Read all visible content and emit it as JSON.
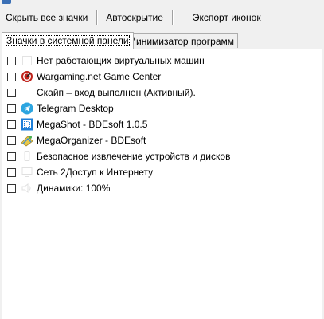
{
  "toolbar": {
    "hide_all": "Скрыть все значки",
    "autohide": "Автоскрытие",
    "export_icons": "Экспорт иконок"
  },
  "tabs": [
    {
      "label": "Значки в системной панели",
      "active": true
    },
    {
      "label": "Минимизатор программ",
      "active": false
    }
  ],
  "tray_items": [
    {
      "label": "Нет работающих виртуальных машин",
      "icon": "vm-icon",
      "checked": false
    },
    {
      "label": "Wargaming.net Game Center",
      "icon": "wargaming-icon",
      "checked": false
    },
    {
      "label": "Скайп – вход выполнен (Активный).",
      "icon": "skype-icon",
      "checked": false
    },
    {
      "label": "Telegram Desktop",
      "icon": "telegram-icon",
      "checked": false
    },
    {
      "label": "MegaShot - BDEsoft 1.0.5",
      "icon": "megashot-icon",
      "checked": false
    },
    {
      "label": "MegaOrganizer - BDEsoft",
      "icon": "megaorganizer-icon",
      "checked": false
    },
    {
      "label": "Безопасное извлечение устройств и дисков",
      "icon": "usb-eject-icon",
      "checked": false
    },
    {
      "label": "Сеть 2Доступ к Интернету",
      "icon": "network-icon",
      "checked": false
    },
    {
      "label": "Динамики: 100%",
      "icon": "speaker-icon",
      "checked": false
    }
  ],
  "colors": {
    "accent": "#0078d7",
    "telegram": "#2ca5e0",
    "wargaming": "#c0231b",
    "megashot": "#1e7fd8"
  }
}
